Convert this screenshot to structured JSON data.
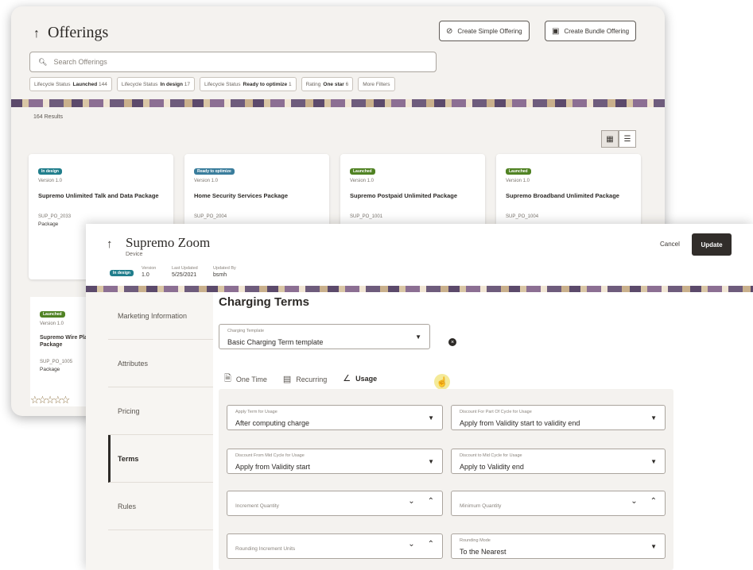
{
  "back": {
    "title": "Offerings",
    "create_simple": "Create Simple Offering",
    "create_bundle": "Create Bundle Offering",
    "search_placeholder": "Search Offerings",
    "chips": [
      {
        "label": "Lifecycle Status",
        "value": "Launched",
        "count": "144"
      },
      {
        "label": "Lifecycle Status",
        "value": "In design",
        "count": "17"
      },
      {
        "label": "Lifecycle Status",
        "value": "Ready to optimize",
        "count": "1"
      },
      {
        "label": "Rating",
        "value": "One star",
        "count": "6"
      },
      {
        "label": "More Filters",
        "value": "",
        "count": ""
      }
    ],
    "results": "164 Results",
    "cards": [
      {
        "badge": "In design",
        "version": "Version 1.0",
        "name": "Supremo Unlimited Talk and Data Package",
        "code": "SUP_PO_2033",
        "type": "Package"
      },
      {
        "badge": "Ready to optimize",
        "version": "Version 1.0",
        "name": "Home Security Services Package",
        "code": "SUP_PO_2004",
        "type": ""
      },
      {
        "badge": "Launched",
        "version": "Version 1.0",
        "name": "Supremo Postpaid Unlimited Package",
        "code": "SUP_PO_1001",
        "type": ""
      },
      {
        "badge": "Launched",
        "version": "Version 1.0",
        "name": "Supremo Broadband Unlimited Package",
        "code": "SUP_PO_1004",
        "type": ""
      }
    ],
    "card5": {
      "badge": "Launched",
      "version": "Version 1.0",
      "name": "Supremo Wire Play Package",
      "code": "SUP_PO_1005",
      "type": "Package"
    }
  },
  "front": {
    "title": "Supremo Zoom",
    "subtitle": "Device",
    "badge": "In design",
    "meta": [
      {
        "label": "Version",
        "value": "1.0"
      },
      {
        "label": "Last Updated",
        "value": "5/25/2021"
      },
      {
        "label": "Updated By",
        "value": "bsmh"
      }
    ],
    "cancel": "Cancel",
    "update": "Update",
    "nav": [
      "Marketing Information",
      "Attributes",
      "Pricing",
      "Terms",
      "Rules"
    ],
    "section_title": "Charging Terms",
    "charging_template": {
      "label": "Charging Template",
      "value": "Basic Charging Term template"
    },
    "tabs": [
      "One Time",
      "Recurring",
      "Usage"
    ],
    "fields": [
      {
        "label": "Apply Term for Usage",
        "value": "After computing charge"
      },
      {
        "label": "Discount For Part Of Cycle for Usage",
        "value": "Apply from Validity start to validity end"
      },
      {
        "label": "Discount From Mid Cycle for Usage",
        "value": "Apply from Validity start"
      },
      {
        "label": "Discount to Mid Cycle for Usage",
        "value": "Apply to Validity end"
      },
      {
        "label": "Increment Quantity",
        "value": ""
      },
      {
        "label": "Minimum Quantity",
        "value": ""
      },
      {
        "label": "Rounding Increment Units",
        "value": ""
      },
      {
        "label": "Rounding Mode",
        "value": "To the Nearest"
      }
    ]
  },
  "colors": {
    "accent_dark": "#312d2a",
    "launched": "#508223",
    "in_design": "#217e8c"
  }
}
